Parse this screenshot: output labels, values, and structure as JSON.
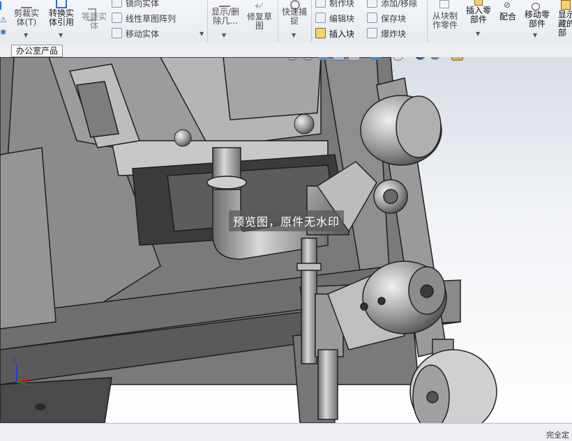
{
  "ribbon": {
    "cut_entity": "剪裁实\n体(T)",
    "convert_entity": "转换实\n体引用",
    "offset_entity": "等距实\n体",
    "mirror_entity": "镜向实体",
    "linear_pattern": "线性草图阵列",
    "move_entity": "移动实体",
    "show_delete": "显示/删\n除几...",
    "repair_sketch": "修复草\n图",
    "quick_snap": "快速捕\n捉",
    "make_block": "制作块",
    "edit_block": "编辑块",
    "insert_block": "插入块",
    "add_remove": "添加/移除",
    "save_block": "保存块",
    "explode_block": "爆炸块",
    "from_block_part": "从块制\n作零件",
    "insert_part": "插入零\n部件",
    "mate": "配合",
    "move_part": "移动零\n部件",
    "show_hidden": "显示\n藏的\n部"
  },
  "tabs": {
    "active_doc": "办公室产品"
  },
  "viewport": {
    "watermark": "预览图，原件无水印",
    "triad": {
      "z": "Z"
    }
  },
  "status": {
    "text": "完全定"
  },
  "colors": {
    "accent": "#2a6fd1",
    "steel": "#8e8e8e",
    "dark": "#3a3a3a"
  }
}
